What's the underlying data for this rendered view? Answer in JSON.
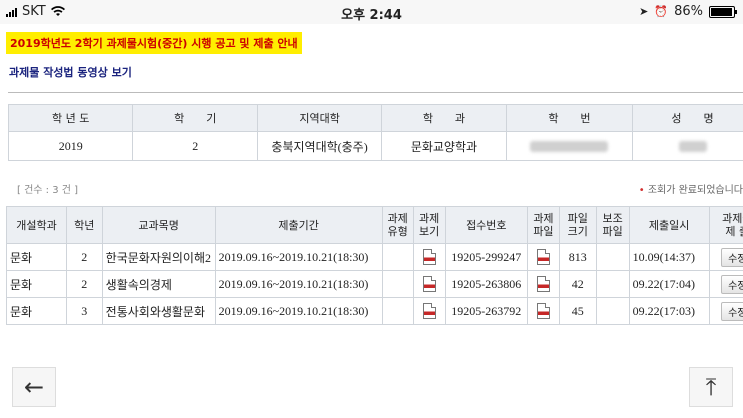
{
  "status_bar": {
    "carrier": "SKT",
    "time": "오후 2:44",
    "battery": "86%",
    "battery_level": 0.86
  },
  "header": {
    "notice": "2019학년도 2학기 과제물시험(중간) 시행 공고 및 제출 안내",
    "video_link": "과제물 작성법 동영상 보기"
  },
  "student_info": {
    "headers": [
      "학 년 도",
      "학　　기",
      "지역대학",
      "학　　과",
      "학　　번",
      "성　　명"
    ],
    "values": [
      "2019",
      "2",
      "충북지역대학(충주)",
      "문화교양학과",
      "",
      ""
    ]
  },
  "summary": {
    "count": "[ 건수 : 3 건 ]",
    "status": "조회가 완료되었습니다"
  },
  "table": {
    "headers": [
      "개설학과",
      "학년",
      "교과목명",
      "제출기간",
      "과제\n유형",
      "과제\n보기",
      "접수번호",
      "과제\n파일",
      "파일\n크기",
      "보조\n파일",
      "제출일시",
      "과제물\n제 출"
    ],
    "rows": [
      {
        "dept": "문화",
        "grade": "2",
        "course": "한국문화자원의이해2",
        "period": "2019.09.16~2019.10.21(18:30)",
        "receipt": "19205-299247",
        "size": "813",
        "submitted": "10.09(14:37)",
        "action": "수정"
      },
      {
        "dept": "문화",
        "grade": "2",
        "course": "생활속의경제",
        "period": "2019.09.16~2019.10.21(18:30)",
        "receipt": "19205-263806",
        "size": "42",
        "submitted": "09.22(17:04)",
        "action": "수정"
      },
      {
        "dept": "문화",
        "grade": "3",
        "course": "전통사회와생활문화",
        "period": "2019.09.16~2019.10.21(18:30)",
        "receipt": "19205-263792",
        "size": "45",
        "submitted": "09.22(17:03)",
        "action": "수정"
      }
    ]
  },
  "nav": {
    "back": "←",
    "top": "⤒"
  },
  "icons": {
    "wifi": "wifi-icon",
    "location": "location-arrow-icon",
    "alarm": "alarm-icon",
    "file": "pdf-file-icon"
  }
}
